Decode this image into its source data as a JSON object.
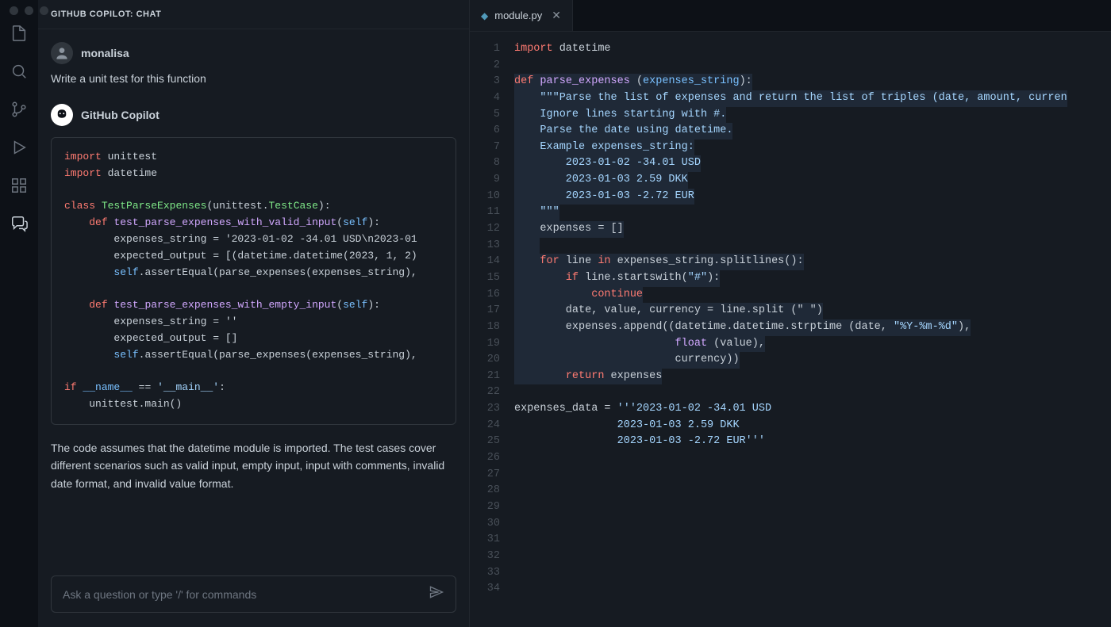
{
  "sidebar": {
    "title": "GITHUB COPILOT: CHAT",
    "user": {
      "name": "monalisa",
      "message": "Write a unit test for this function"
    },
    "agent": {
      "name": "GitHub Copilot",
      "code": {
        "l1_kw": "import",
        "l1_mod": "unittest",
        "l2_kw": "import",
        "l2_mod": "datetime",
        "l3_kw": "class",
        "l3_cls": "TestParseExpenses",
        "l3_base": "unittest",
        "l3_tc": "TestCase",
        "l4_kw": "def",
        "l4_fn": "test_parse_expenses_with_valid_input",
        "l4_self": "self",
        "l5": "        expenses_string = '2023-01-02 -34.01 USD\\n2023-01",
        "l6": "        expected_output = [(datetime.datetime(2023, 1, 2)",
        "l7_a": "        ",
        "l7_self": "self",
        "l7_b": ".assertEqual(parse_expenses(expenses_string),",
        "l8_kw": "def",
        "l8_fn": "test_parse_expenses_with_empty_input",
        "l8_self": "self",
        "l9": "        expenses_string = ''",
        "l10": "        expected_output = []",
        "l11_a": "        ",
        "l11_self": "self",
        "l11_b": ".assertEqual(parse_expenses(expenses_string),",
        "l12_kw": "if",
        "l12_name": "__name__",
        "l12_eq": " == ",
        "l12_main": "'__main__'",
        "l13": "    unittest.main()"
      },
      "explanation": "The code assumes that the datetime module is imported. The test cases cover different scenarios such as valid input, empty input, input with comments, invalid date format, and invalid value format."
    },
    "input_placeholder": "Ask a question or type '/' for commands"
  },
  "editor": {
    "tab": {
      "filename": "module.py"
    },
    "line_count": 34,
    "code": {
      "l1_kw": "import",
      "l1_mod": " datetime",
      "l3_kw": "def",
      "l3_fn": "parse_expenses",
      "l3_arg": "expenses_string",
      "l4": "    \"\"\"Parse the list of expenses and return the list of triples (date, amount, curren",
      "l5": "    Ignore lines starting with #.",
      "l6": "    Parse the date using datetime.",
      "l7": "    Example expenses_string:",
      "l8": "        2023-01-02 -34.01 USD",
      "l9": "        2023-01-03 2.59 DKK",
      "l10": "        2023-01-03 -2.72 EUR",
      "l11": "    \"\"\"",
      "l12": "    expenses = []",
      "l14_a": "    ",
      "l14_for": "for",
      "l14_b": " line ",
      "l14_in": "in",
      "l14_c": " expenses_string.splitlines():",
      "l15_a": "        ",
      "l15_if": "if",
      "l15_b": " line.startswith(",
      "l15_str": "\"#\"",
      "l15_c": "):",
      "l16_a": "            ",
      "l16_cont": "continue",
      "l17": "        date, value, currency = line.split (\" \")",
      "l18_a": "        expenses.append((datetime.datetime.strptime (date, ",
      "l18_str": "\"%Y-%m-%d\"",
      "l18_b": "),",
      "l19_a": "                         ",
      "l19_fn": "float",
      "l19_b": " (value),",
      "l20": "                         currency))",
      "l21_a": "        ",
      "l21_ret": "return",
      "l21_b": " expenses",
      "l23_a": "expenses_data = ",
      "l23_str": "'''2023-01-02 -34.01 USD",
      "l24": "                2023-01-03 2.59 DKK",
      "l25": "                2023-01-03 -2.72 EUR'''"
    }
  }
}
